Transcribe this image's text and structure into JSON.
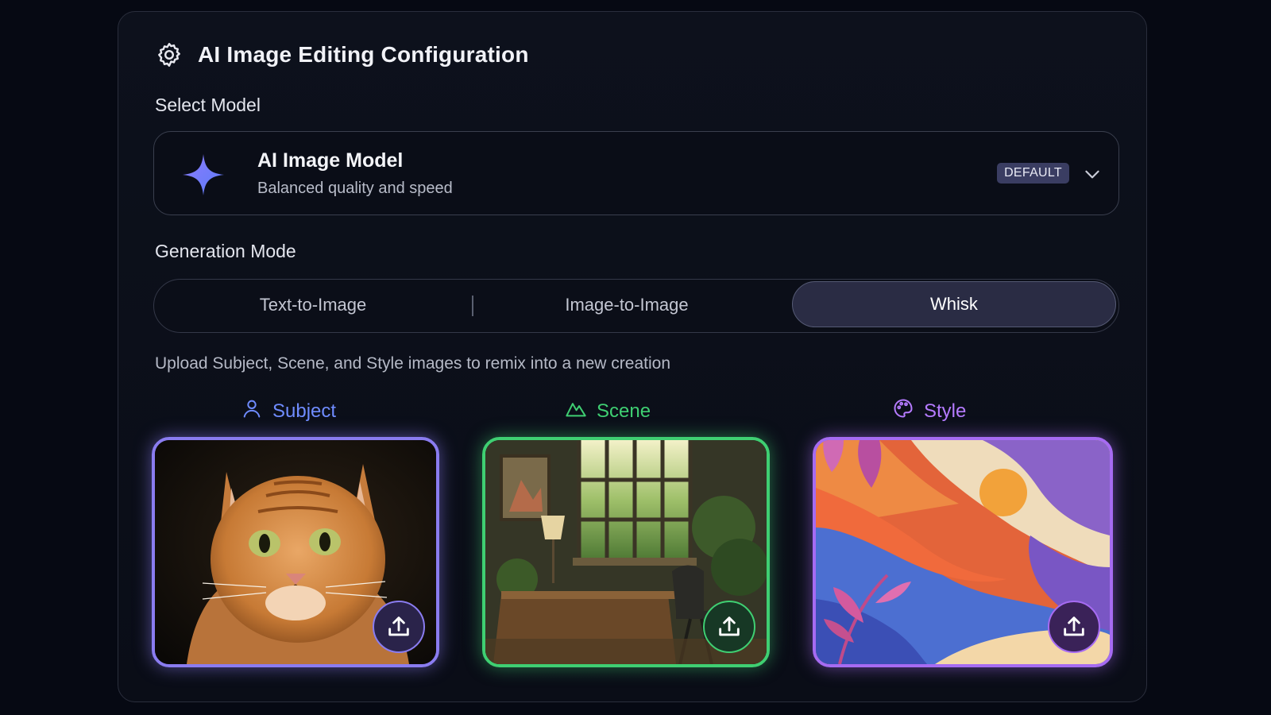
{
  "header": {
    "title": "AI Image Editing Configuration",
    "icon": "gear-icon"
  },
  "model": {
    "section_label": "Select Model",
    "name": "AI Image Model",
    "description": "Balanced quality and speed",
    "badge": "DEFAULT",
    "icon": "sparkle-icon",
    "accent": "#7b6cf6"
  },
  "generation": {
    "section_label": "Generation Mode",
    "tabs": [
      {
        "label": "Text-to-Image",
        "selected": false
      },
      {
        "label": "Image-to-Image",
        "selected": false
      },
      {
        "label": "Whisk",
        "selected": true
      }
    ],
    "helper_text": "Upload Subject, Scene, and Style images to remix into a new creation"
  },
  "slots": [
    {
      "label": "Subject",
      "icon": "person-icon",
      "color": "#6f8cff",
      "border": "#8a7cf0",
      "image": "orange tabby cat portrait"
    },
    {
      "label": "Scene",
      "icon": "mountain-icon",
      "color": "#3fcf72",
      "border": "#3fcf72",
      "image": "sunlit study room with window and desk"
    },
    {
      "label": "Style",
      "icon": "palette-icon",
      "color": "#b57bff",
      "border": "#a66bf2",
      "image": "layered paper-cut landscape with orange sun"
    }
  ]
}
